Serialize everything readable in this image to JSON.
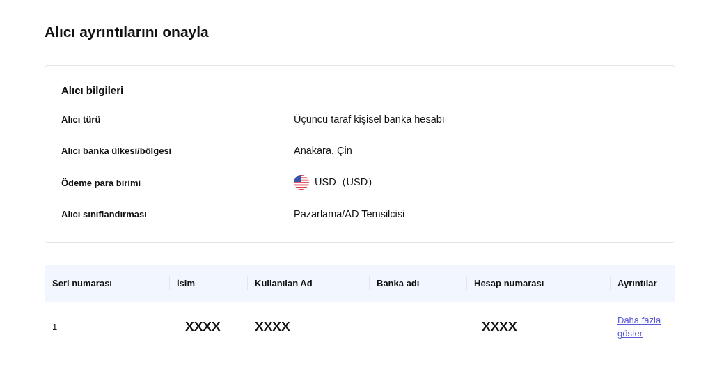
{
  "title": "Alıcı ayrıntılarını onayla",
  "recipient_info": {
    "heading": "Alıcı bilgileri",
    "rows": [
      {
        "kind": "text",
        "label": "Alıcı türü",
        "value": "Üçüncü taraf kişisel banka hesabı"
      },
      {
        "kind": "text",
        "label": "Alıcı banka ülkesi/bölgesi",
        "value": "Anakara, Çin"
      },
      {
        "kind": "currency",
        "label": "Ödeme para birimi",
        "value": "USD（USD）"
      },
      {
        "kind": "text",
        "label": "Alıcı sınıflandırması",
        "value": "Pazarlama/AD Temsilcisi"
      }
    ]
  },
  "table": {
    "columns": [
      "Seri numarası",
      "İsim",
      "Kullanılan Ad",
      "Banka adı",
      "Hesap numarası",
      "Ayrıntılar"
    ],
    "rows": [
      {
        "serial": "1",
        "name": "XXXX",
        "used_name": "XXXX",
        "account_number": "XXXX",
        "details_link": "Daha fazla göster"
      }
    ]
  }
}
